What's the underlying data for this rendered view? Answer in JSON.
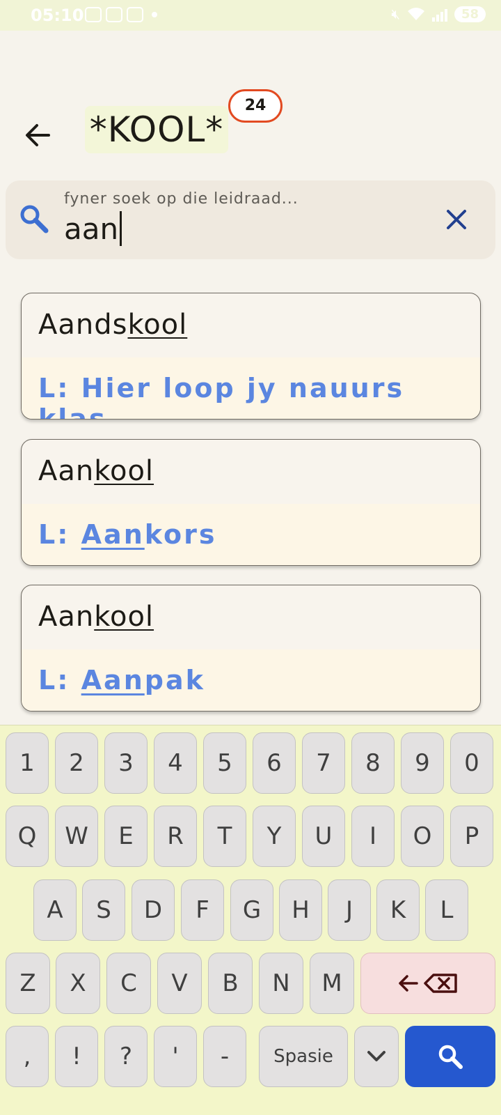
{
  "status_bar": {
    "time": "05:10",
    "battery": "58"
  },
  "header": {
    "title": "*KOOL*",
    "count": "24"
  },
  "search": {
    "label": "fyner soek op die leidraad...",
    "value": "aan"
  },
  "results": [
    {
      "word_prefix": "Aands",
      "word_match": "kool",
      "clue_prefix": "L: ",
      "clue_match": "",
      "clue_rest": "Hier loop jy nauurs klas"
    },
    {
      "word_prefix": "Aan",
      "word_match": "kool",
      "clue_prefix": "L: ",
      "clue_match": "Aan",
      "clue_rest": "kors"
    },
    {
      "word_prefix": "Aan",
      "word_match": "kool",
      "clue_prefix": "L: ",
      "clue_match": "Aan",
      "clue_rest": "pak"
    }
  ],
  "keyboard": {
    "row1": [
      "1",
      "2",
      "3",
      "4",
      "5",
      "6",
      "7",
      "8",
      "9",
      "0"
    ],
    "row2": [
      "Q",
      "W",
      "E",
      "R",
      "T",
      "Y",
      "U",
      "I",
      "O",
      "P"
    ],
    "row3": [
      "A",
      "S",
      "D",
      "F",
      "G",
      "H",
      "J",
      "K",
      "L"
    ],
    "row4": [
      "Z",
      "X",
      "C",
      "V",
      "B",
      "N",
      "M"
    ],
    "row5": [
      ",",
      "!",
      "?",
      "'",
      "-"
    ],
    "space_label": "Spasie"
  },
  "colors": {
    "accent": "#2558cf",
    "badge_border": "#e24a21",
    "clue_text": "#5b86e0",
    "keyboard_bg": "#f3f6c9"
  },
  "icons": [
    "back-arrow-icon",
    "search-icon",
    "close-icon",
    "backspace-icon",
    "chevron-down-icon"
  ]
}
